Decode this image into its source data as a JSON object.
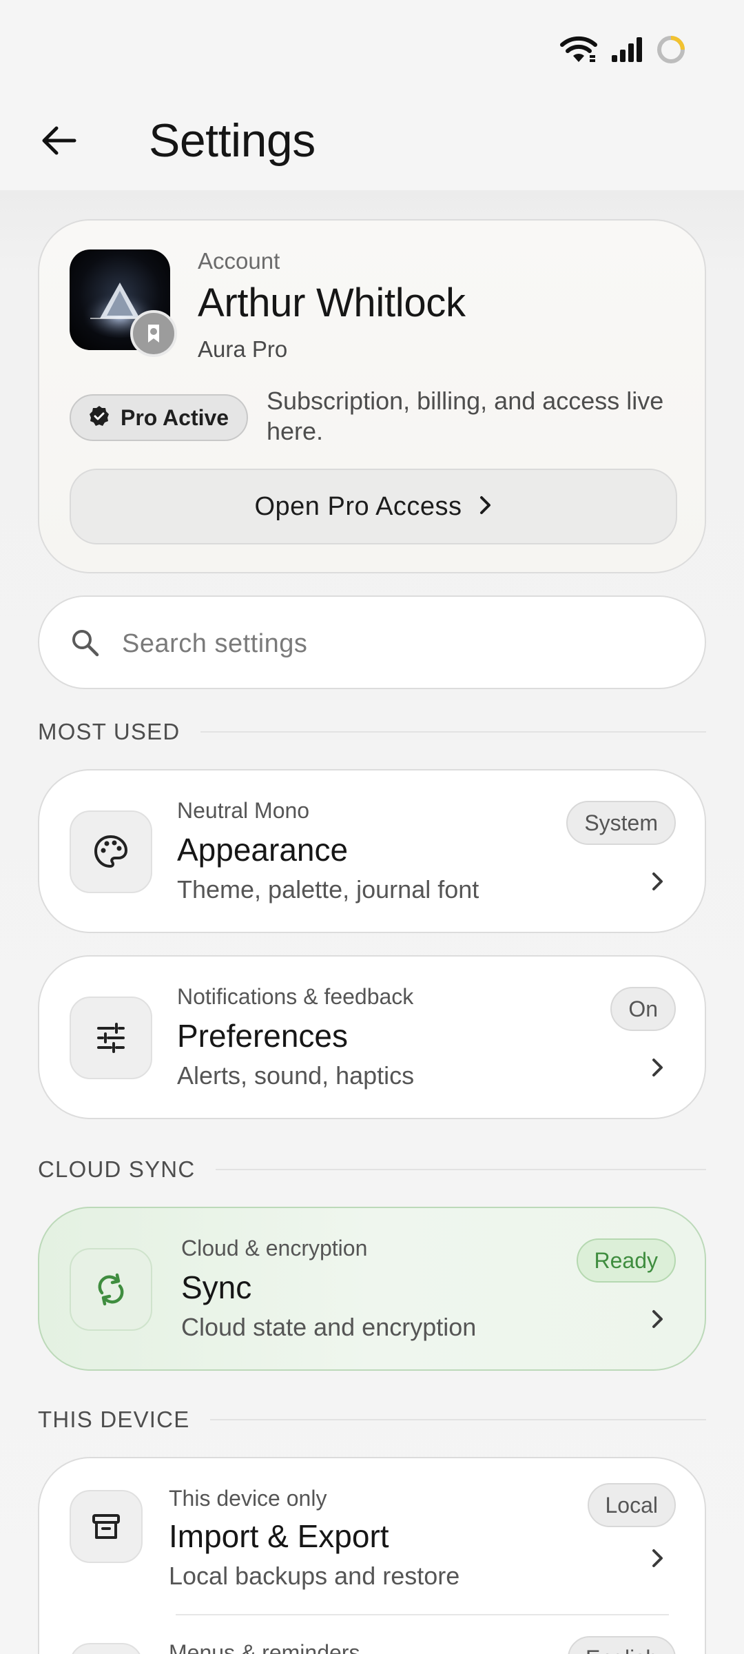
{
  "status_bar": {
    "icons": [
      "wifi-icon",
      "signal-icon",
      "battery-ring-icon"
    ]
  },
  "app_bar": {
    "title": "Settings"
  },
  "account": {
    "label": "Account",
    "name": "Arthur Whitlock",
    "plan": "Aura Pro",
    "badge": "Pro Active",
    "description": "Subscription, billing, and access live here.",
    "button_label": "Open Pro Access"
  },
  "search": {
    "placeholder": "Search settings"
  },
  "sections": {
    "most_used": "MOST USED",
    "cloud_sync": "CLOUD SYNC",
    "this_device": "THIS DEVICE"
  },
  "items": {
    "appearance": {
      "kicker": "Neutral Mono",
      "title": "Appearance",
      "subtitle": "Theme, palette, journal font",
      "badge": "System",
      "icon": "palette-icon"
    },
    "preferences": {
      "kicker": "Notifications & feedback",
      "title": "Preferences",
      "subtitle": "Alerts, sound, haptics",
      "badge": "On",
      "icon": "sliders-icon"
    },
    "sync": {
      "kicker": "Cloud & encryption",
      "title": "Sync",
      "subtitle": "Cloud state and encryption",
      "badge": "Ready",
      "icon": "sync-icon"
    },
    "import_export": {
      "kicker": "This device only",
      "title": "Import & Export",
      "subtitle": "Local backups and restore",
      "badge": "Local",
      "icon": "archive-icon"
    },
    "reminders_partial": {
      "kicker": "Menus & reminders",
      "badge": "English"
    }
  },
  "colors": {
    "accent_green": "#3f8d3f",
    "background": "#f4f4f4"
  }
}
